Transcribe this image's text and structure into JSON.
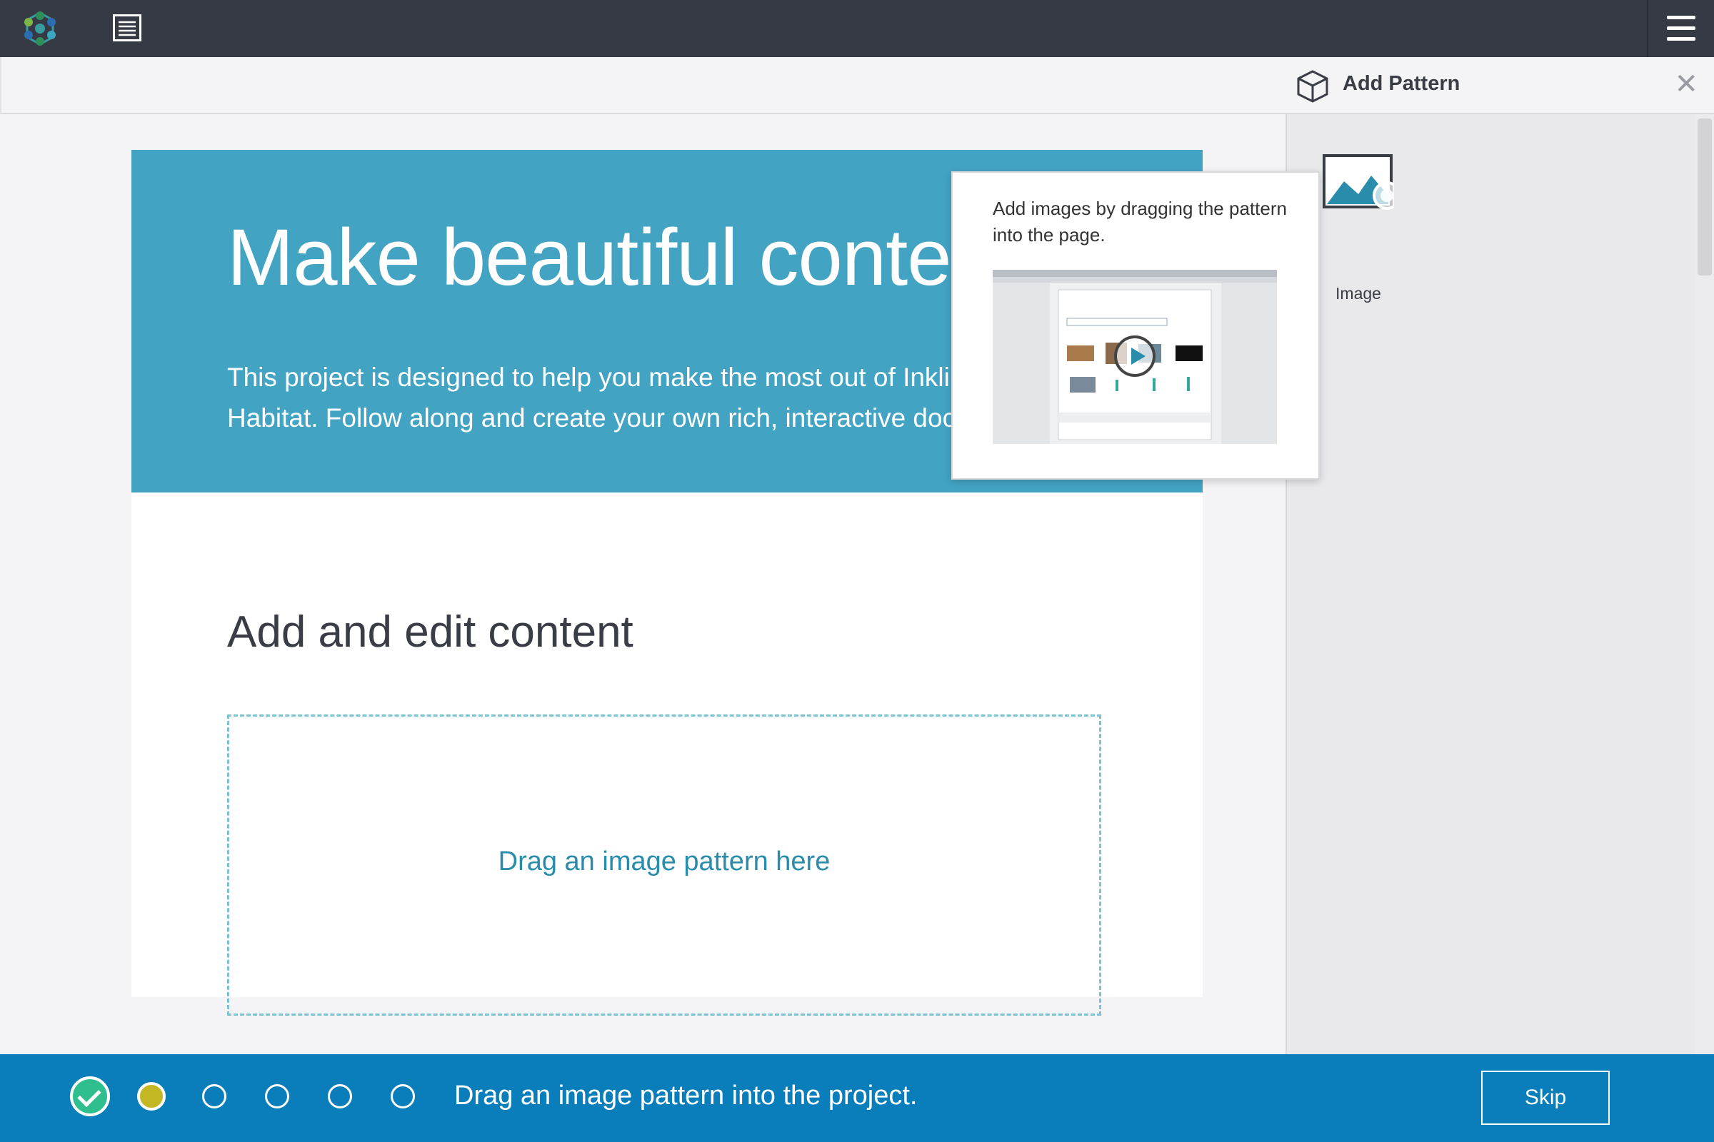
{
  "panel": {
    "title": "Add Pattern",
    "close_icon": "close-icon",
    "patterns": [
      {
        "label": "Image",
        "icon": "image-icon"
      }
    ]
  },
  "tooltip": {
    "text": "Add images by dragging the pattern into the page.",
    "video_icon": "play-icon"
  },
  "page": {
    "hero_title": "Make beautiful content",
    "hero_body": "This project is designed to help you make the most out of Inkling Habitat. Follow along and create your own rich, interactive document.",
    "section_title": "Add and edit content",
    "dropzone_text": "Drag an image pattern here"
  },
  "tutorial": {
    "instruction": "Drag an image pattern into the project.",
    "skip_label": "Skip",
    "steps": [
      "done",
      "current",
      "pending",
      "pending",
      "pending",
      "pending"
    ]
  },
  "colors": {
    "topbar": "#363a44",
    "hero": "#43a3c3",
    "accent": "#2a8cab",
    "bottombar": "#0a7eba",
    "step_done": "#2fbf8e",
    "step_current": "#c3b724"
  }
}
